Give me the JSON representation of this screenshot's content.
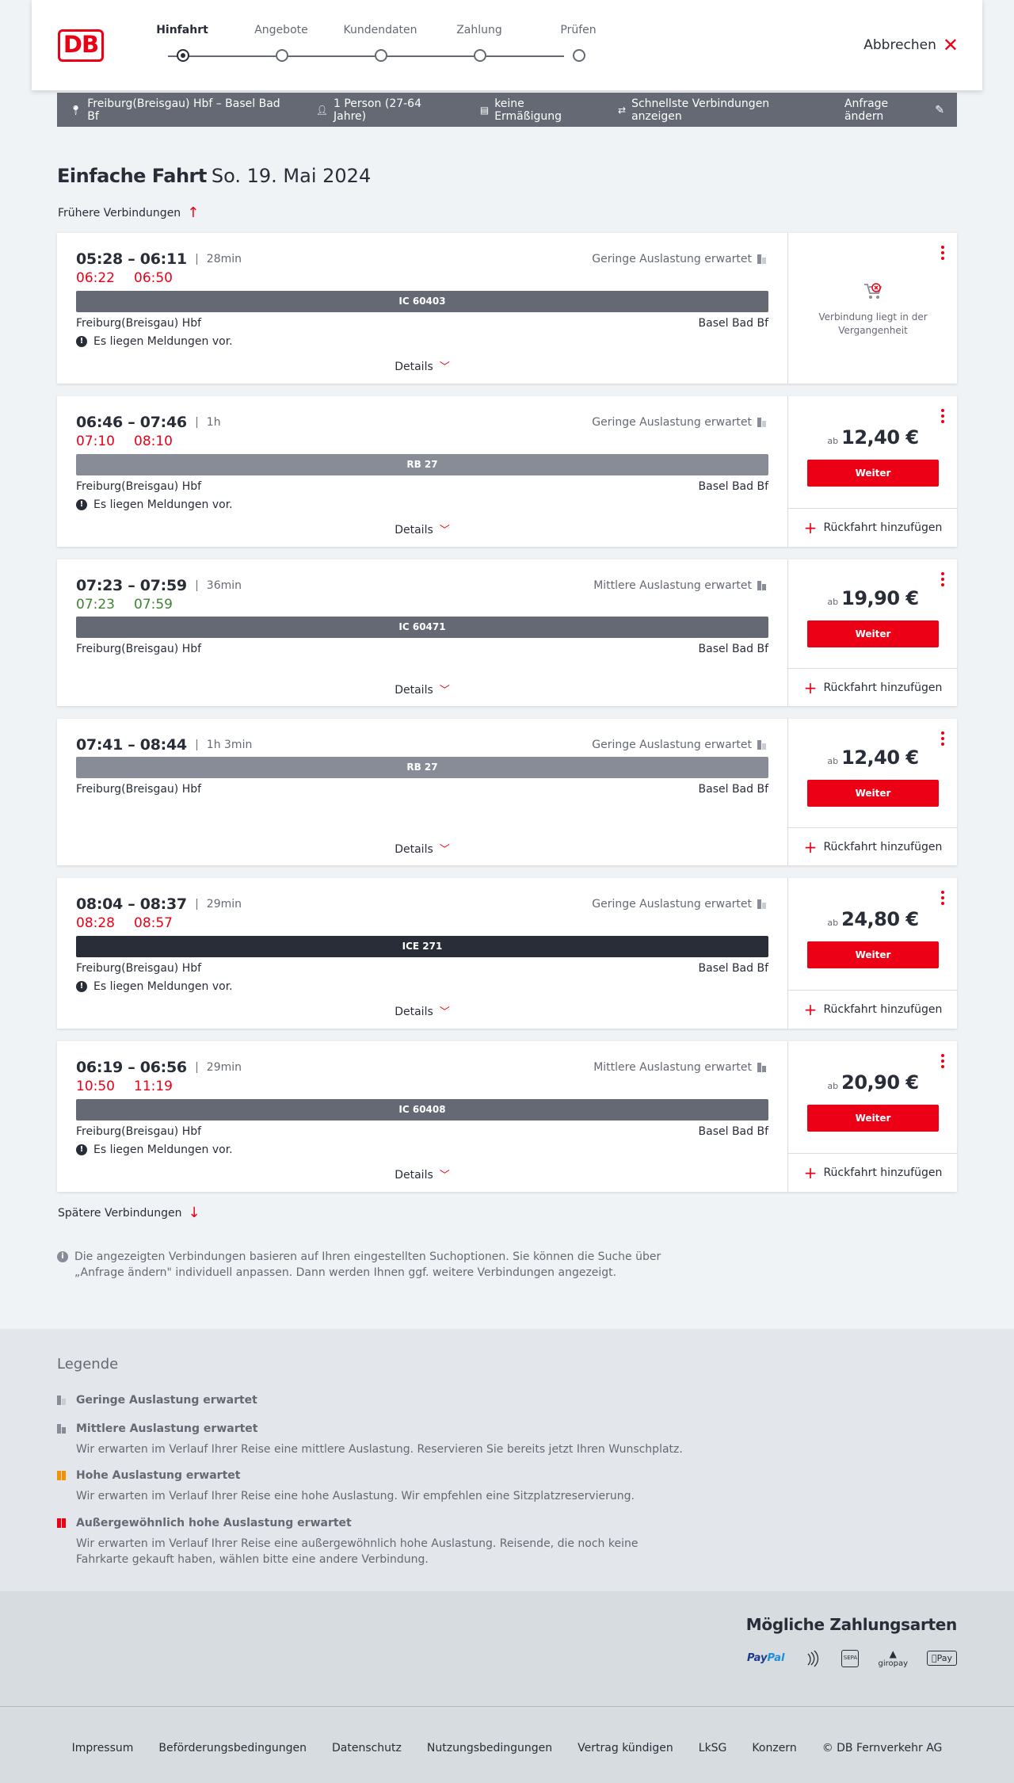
{
  "header": {
    "logo": "DB",
    "steps": [
      "Hinfahrt",
      "Angebote",
      "Kundendaten",
      "Zahlung",
      "Prüfen"
    ],
    "active_step": 0,
    "cancel_label": "Abbrechen"
  },
  "filter": {
    "route": "Freiburg(Breisgau) Hbf – Basel Bad Bf",
    "passengers": "1 Person (27-64 Jahre)",
    "discount": "keine Ermäßigung",
    "fastest": "Schnellste Verbindungen anzeigen",
    "change": "Anfrage ändern"
  },
  "title": {
    "type": "Einfache Fahrt",
    "date": "So. 19. Mai 2024"
  },
  "earlier_label": "Frühere Verbindungen",
  "later_label": "Spätere Verbindungen",
  "details_label": "Details",
  "weiter_label": "Weiter",
  "return_label": "Rückfahrt hinzufügen",
  "price_prefix": "ab",
  "message_label": "Es liegen Meldungen vor.",
  "connections": [
    {
      "times": "05:28 – 06:11",
      "duration": "28min",
      "load": "Geringe Auslastung erwartet",
      "rt_dep": "06:22",
      "rt_arr": "06:50",
      "train": "IC 60403",
      "from": "Freiburg(Breisgau) Hbf",
      "to": "Basel Bad Bf",
      "past_text": "Verbindung liegt in der Vergangenheit"
    },
    {
      "times": "06:46 – 07:46",
      "duration": "1h",
      "load": "Geringe Auslastung erwartet",
      "rt_dep": "07:10",
      "rt_arr": "08:10",
      "train": "RB 27",
      "from": "Freiburg(Breisgau) Hbf",
      "to": "Basel Bad Bf",
      "price": "12,40 €"
    },
    {
      "times": "07:23 – 07:59",
      "duration": "36min",
      "load": "Mittlere Auslastung erwartet",
      "rt_dep": "07:23",
      "rt_arr": "07:59",
      "train": "IC 60471",
      "from": "Freiburg(Breisgau) Hbf",
      "to": "Basel Bad Bf",
      "price": "19,90 €"
    },
    {
      "times": "07:41 – 08:44",
      "duration": "1h 3min",
      "load": "Geringe Auslastung erwartet",
      "train": "RB 27",
      "from": "Freiburg(Breisgau) Hbf",
      "to": "Basel Bad Bf",
      "price": "12,40 €"
    },
    {
      "times": "08:04 – 08:37",
      "duration": "29min",
      "load": "Geringe Auslastung erwartet",
      "rt_dep": "08:28",
      "rt_arr": "08:57",
      "train": "ICE 271",
      "from": "Freiburg(Breisgau) Hbf",
      "to": "Basel Bad Bf",
      "price": "24,80 €"
    },
    {
      "times": "06:19 – 06:56",
      "duration": "29min",
      "load": "Mittlere Auslastung erwartet",
      "rt_dep": "10:50",
      "rt_arr": "11:19",
      "train": "IC 60408",
      "from": "Freiburg(Breisgau) Hbf",
      "to": "Basel Bad Bf",
      "price": "20,90 €"
    }
  ],
  "info_text": "Die angezeigten Verbindungen basieren auf Ihren eingestellten Suchoptionen. Sie können die Suche über „Anfrage ändern\" individuell anpassen. Dann werden Ihnen ggf. weitere Verbindungen angezeigt.",
  "legend": {
    "title": "Legende",
    "items": [
      {
        "title": "Geringe Auslastung erwartet",
        "desc": ""
      },
      {
        "title": "Mittlere Auslastung erwartet",
        "desc": "Wir erwarten im Verlauf Ihrer Reise eine mittlere Auslastung. Reservieren Sie bereits jetzt Ihren Wunschplatz."
      },
      {
        "title": "Hohe Auslastung erwartet",
        "desc": "Wir erwarten im Verlauf Ihrer Reise eine hohe Auslastung. Wir empfehlen eine Sitzplatzreservierung."
      },
      {
        "title": "Außergewöhnlich hohe Auslastung erwartet",
        "desc": "Wir erwarten im Verlauf Ihrer Reise eine außergewöhnlich hohe Auslastung. Reisende, die noch keine Fahrkarte gekauft haben, wählen bitte eine andere Verbindung."
      }
    ]
  },
  "payment": {
    "title": "Mögliche Zahlungsarten",
    "paypal_a": "Pay",
    "paypal_b": "Pal",
    "sepa": "SEPA",
    "giropay": "giropay",
    "applepay": "Pay"
  },
  "footer": [
    "Impressum",
    "Beförderungsbedingungen",
    "Datenschutz",
    "Nutzungsbedingungen",
    "Vertrag kündigen",
    "LkSG",
    "Konzern",
    "© DB Fernverkehr AG"
  ],
  "colors": {
    "accent": "#ec0016",
    "delay": "#ec0016",
    "ontime": "#408335",
    "bar_ic": "#646973",
    "bar_rb": "#878c96",
    "bar_ice": "#282d37"
  }
}
